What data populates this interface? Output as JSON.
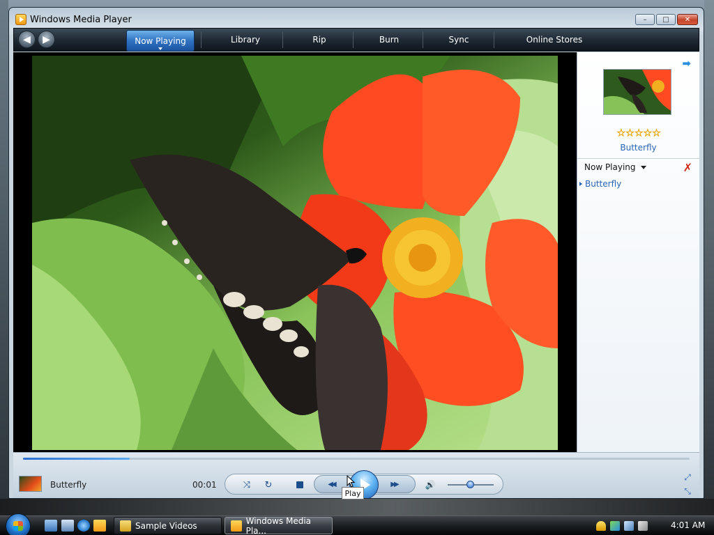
{
  "window": {
    "title": "Windows Media Player",
    "buttons": {
      "minimize": "–",
      "maximize": "□",
      "close": "✕"
    }
  },
  "nav": {
    "back": "◀",
    "forward": "▶",
    "tabs": [
      {
        "label": "Now Playing",
        "active": true
      },
      {
        "label": "Library"
      },
      {
        "label": "Rip"
      },
      {
        "label": "Burn"
      },
      {
        "label": "Sync"
      },
      {
        "label": "Online Stores"
      }
    ]
  },
  "video": {
    "subject": "butterfly on red flower"
  },
  "pane": {
    "arrow": "➡",
    "rating_stars": 5,
    "rating_value": 0,
    "album_title": "Butterfly",
    "list_header": "Now Playing",
    "clear_icon": "✗",
    "playlist": [
      {
        "title": "Butterfly"
      }
    ]
  },
  "controls": {
    "track_title": "Butterfly",
    "time": "00:01",
    "progress": 0.16,
    "volume": 0.5,
    "shuffle_icon": "⤨",
    "repeat_icon": "↻",
    "prev_icon": "◀◀",
    "next_icon": "▶▶",
    "mute_icon": "🔊",
    "tooltip": "Play",
    "switch_icon": "⤢",
    "compact_icon": "⤡"
  },
  "taskbar": {
    "tasks": [
      {
        "label": "Sample Videos",
        "icon_color": "#e8c03a"
      },
      {
        "label": "Windows Media Pla...",
        "icon_color": "#f2a326",
        "active": true
      }
    ],
    "clock": "4:01 AM"
  },
  "colors": {
    "accent": "#2865b8",
    "nav_active": "#2f73c2",
    "close_red": "#c4442c"
  }
}
